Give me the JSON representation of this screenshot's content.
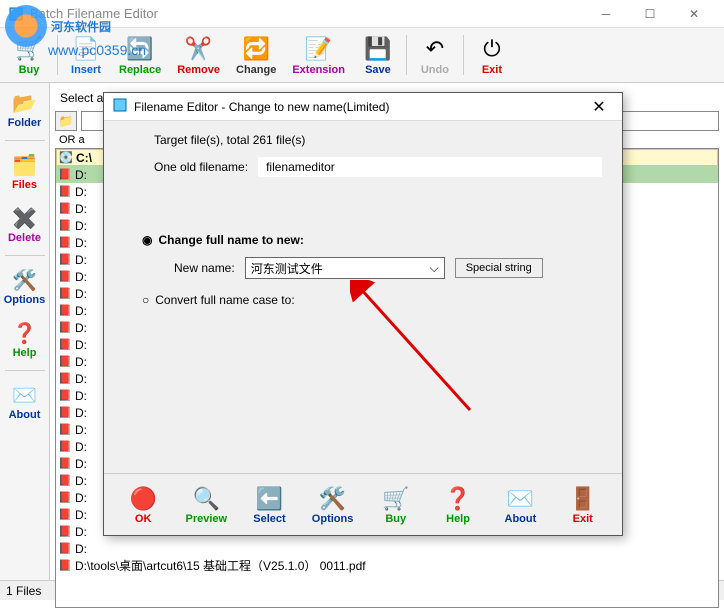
{
  "window": {
    "title": "Batch Filename Editor"
  },
  "watermark": {
    "text": "河东软件园",
    "url": "www.pc0359.cn"
  },
  "toolbar": {
    "buy": "Buy",
    "insert": "Insert",
    "replace": "Replace",
    "remove": "Remove",
    "change": "Change",
    "extension": "Extension",
    "save": "Save",
    "undo": "Undo",
    "exit": "Exit"
  },
  "sidebar": {
    "folder": "Folder",
    "files": "Files",
    "delete": "Delete",
    "options": "Options",
    "help": "Help",
    "about": "About"
  },
  "work": {
    "hint": "Select a folder to edit all its included file names together",
    "or_and": "OR a",
    "drive": "C:\\"
  },
  "files": [
    "D:",
    "D:",
    "D:",
    "D:",
    "D:",
    "D:",
    "D:",
    "D:",
    "D:",
    "D:",
    "D:",
    "D:",
    "D:",
    "D:",
    "D:",
    "D:",
    "D:",
    "D:",
    "D:",
    "D:",
    "D:",
    "D:",
    "D:",
    "D:\\tools\\桌面\\artcut6\\15 基础工程（V25.1.0） 0011.pdf"
  ],
  "dialog": {
    "title": "Filename Editor - Change to new name(Limited)",
    "target": "Target file(s),   total 261 file(s)",
    "old_label": "One old filename:",
    "old_value": "filenameditor",
    "radio_full": "Change full name to new:",
    "new_name_label": "New name:",
    "new_name_value": "河东测试文件",
    "special": "Special string",
    "radio_case": "Convert full name case to:",
    "buttons": {
      "ok": "OK",
      "preview": "Preview",
      "select": "Select",
      "options": "Options",
      "buy": "Buy",
      "help": "Help",
      "about": "About",
      "exit": "Exit"
    }
  },
  "status": {
    "files": "1 Files"
  }
}
